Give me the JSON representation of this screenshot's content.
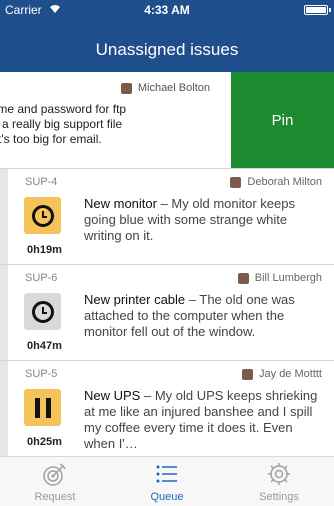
{
  "status_bar": {
    "carrier": "Carrier",
    "time": "4:33 AM",
    "battery_level": 1.0
  },
  "header": {
    "title": "Unassigned issues"
  },
  "swiped_row": {
    "reporter": "Michael Bolton",
    "text_line1": "orary username and password for ftp",
    "text_line2": "ed to receive a really big support file",
    "text_line3": "a customer, it's too big for email.",
    "action_label": "Pin",
    "action_color": "#1c8a2e"
  },
  "issues": [
    {
      "id": "SUP-4",
      "reporter": "Deborah Milton",
      "elapsed": "0h19m",
      "subject": "New monitor",
      "description": " – My old monitor keeps going blue with some strange white writing on it.",
      "status_icon": "clock-icon",
      "status_color": "#f5c35a"
    },
    {
      "id": "SUP-6",
      "reporter": "Bill Lumbergh",
      "elapsed": "0h47m",
      "subject": "New printer cable",
      "description": " – The old one was attached to the computer when the monitor fell out of the window.",
      "status_icon": "clock-icon",
      "status_color": "#d9d9d9"
    },
    {
      "id": "SUP-5",
      "reporter": "Jay de Motttt",
      "elapsed": "0h25m",
      "subject": "New UPS",
      "description": " – My old UPS keeps shrieking at me like an injured banshee and I spill my coffee every time it does it. Even when I'…",
      "status_icon": "pause-icon",
      "status_color": "#f5c35a"
    }
  ],
  "tabs": [
    {
      "label": "Request",
      "icon": "target-icon",
      "active": false
    },
    {
      "label": "Queue",
      "icon": "list-icon",
      "active": true
    },
    {
      "label": "Settings",
      "icon": "gear-icon",
      "active": false
    }
  ],
  "colors": {
    "header_bg": "#1f4e8c",
    "active_tab": "#1f66c1",
    "inactive_tab": "#9a9a9a"
  }
}
